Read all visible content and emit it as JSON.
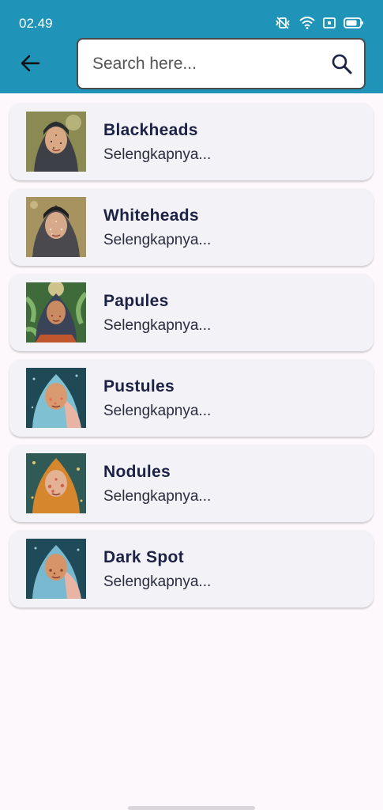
{
  "status_bar": {
    "time": "02.49",
    "icons": [
      "vibrate-icon",
      "wifi-icon",
      "nfc-icon",
      "battery-icon"
    ]
  },
  "header": {
    "back_icon": "arrow-left-icon",
    "search": {
      "placeholder": "Search here...",
      "value": "",
      "icon": "search-icon"
    }
  },
  "colors": {
    "appbar": "#1f93b8",
    "card": "#f3f2f7",
    "title": "#1c2245",
    "background": "#fcf8fb"
  },
  "items": [
    {
      "title": "Blackheads",
      "subtitle": "Selengkapnya...",
      "image": "blackheads-thumbnail"
    },
    {
      "title": "Whiteheads",
      "subtitle": "Selengkapnya...",
      "image": "whiteheads-thumbnail"
    },
    {
      "title": "Papules",
      "subtitle": "Selengkapnya...",
      "image": "papules-thumbnail"
    },
    {
      "title": "Pustules",
      "subtitle": "Selengkapnya...",
      "image": "pustules-thumbnail"
    },
    {
      "title": "Nodules",
      "subtitle": "Selengkapnya...",
      "image": "nodules-thumbnail"
    },
    {
      "title": "Dark Spot",
      "subtitle": "Selengkapnya...",
      "image": "dark-spot-thumbnail"
    }
  ]
}
